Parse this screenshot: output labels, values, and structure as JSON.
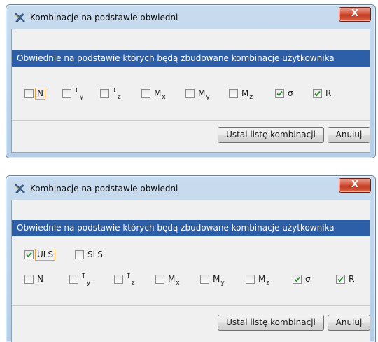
{
  "dialogs": [
    {
      "title": "Kombinacje na podstawie obwiedni",
      "close_label": "X",
      "header": "Obwiednie na podstawie których będą zbudowane kombinacje użytkownika",
      "checkboxes": [
        {
          "main": "N",
          "sup": "",
          "sub": "",
          "checked": false,
          "focused": true
        },
        {
          "main": "",
          "sup": "T",
          "sub": "y",
          "checked": false
        },
        {
          "main": "",
          "sup": "T",
          "sub": "z",
          "checked": false
        },
        {
          "main": "M",
          "sup": "",
          "sub": "x",
          "checked": false
        },
        {
          "main": "M",
          "sup": "",
          "sub": "y",
          "checked": false
        },
        {
          "main": "M",
          "sup": "",
          "sub": "z",
          "checked": false
        },
        {
          "main": "σ",
          "sup": "",
          "sub": "",
          "checked": true
        },
        {
          "main": "R",
          "sup": "",
          "sub": "",
          "checked": true
        }
      ],
      "ok_button": "Ustal listę kombinacji",
      "cancel_button": "Anuluj"
    },
    {
      "title": "Kombinacje na podstawie obwiedni",
      "close_label": "X",
      "header": "Obwiednie na podstawie których będą zbudowane kombinacje użytkownika",
      "states": [
        {
          "label": "ULS",
          "checked": true,
          "focused": true
        },
        {
          "label": "SLS",
          "checked": false
        }
      ],
      "checkboxes": [
        {
          "main": "N",
          "sup": "",
          "sub": "",
          "checked": false
        },
        {
          "main": "",
          "sup": "T",
          "sub": "y",
          "checked": false
        },
        {
          "main": "",
          "sup": "T",
          "sub": "z",
          "checked": false
        },
        {
          "main": "M",
          "sup": "",
          "sub": "x",
          "checked": false
        },
        {
          "main": "M",
          "sup": "",
          "sub": "y",
          "checked": false
        },
        {
          "main": "M",
          "sup": "",
          "sub": "z",
          "checked": false
        },
        {
          "main": "σ",
          "sup": "",
          "sub": "",
          "checked": true
        },
        {
          "main": "R",
          "sup": "",
          "sub": "",
          "checked": true
        }
      ],
      "ok_button": "Ustal listę kombinacji",
      "cancel_button": "Anuluj"
    }
  ],
  "colors": {
    "header_bg": "#2d5fa8",
    "focus_border": "#f0a030",
    "check_mark": "#2e8b2e"
  }
}
